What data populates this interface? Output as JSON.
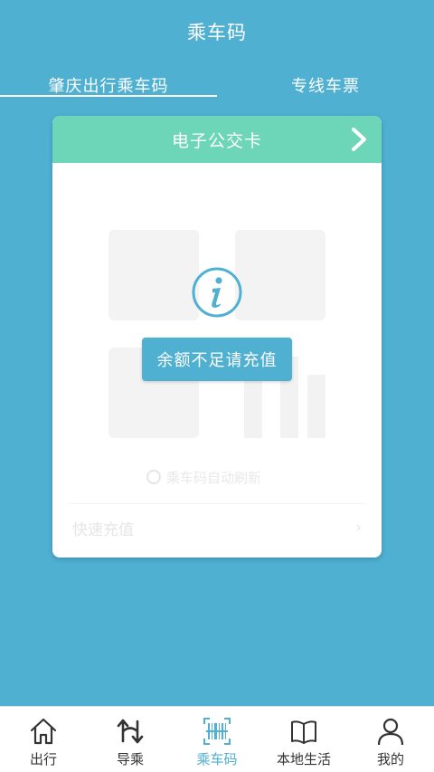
{
  "header": {
    "title": "乘车码"
  },
  "tabs": [
    {
      "label": "肇庆出行乘车码",
      "active": true
    },
    {
      "label": "专线车票",
      "active": false
    }
  ],
  "card": {
    "title": "电子公交卡",
    "message_button": "余额不足请充值",
    "auto_refresh_label": "乘车码自动刷新",
    "quick_recharge_label": "快速充值",
    "quick_recharge_arrow": "›"
  },
  "bottom_nav": [
    {
      "label": "出行",
      "icon": "home-icon",
      "active": false
    },
    {
      "label": "导乘",
      "icon": "route-icon",
      "active": false
    },
    {
      "label": "乘车码",
      "icon": "barcode-scan-icon",
      "active": true
    },
    {
      "label": "本地生活",
      "icon": "book-icon",
      "active": false
    },
    {
      "label": "我的",
      "icon": "user-icon",
      "active": false
    }
  ],
  "colors": {
    "background": "#4fb0d2",
    "card_header": "#6dd5b8",
    "accent": "#4fb0d2",
    "nav_text": "#333333"
  }
}
